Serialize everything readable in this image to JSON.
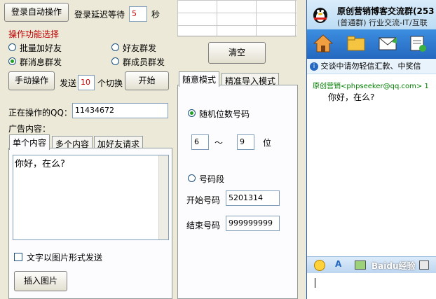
{
  "left": {
    "login_button": "登录自动操作",
    "delay_label": "登录延迟等待",
    "delay_value": "5",
    "delay_unit": "秒",
    "section_title": "操作功能选择",
    "radios": [
      {
        "label": "批量加好友",
        "checked": false
      },
      {
        "label": "好友群发",
        "checked": false
      },
      {
        "label": "群消息群发",
        "checked": true
      },
      {
        "label": "群成员群发",
        "checked": false
      }
    ],
    "manual_button": "手动操作",
    "send_label": "发送",
    "send_value": "10",
    "switch_label": "个切换",
    "start_button": "开始",
    "current_qq_label": "正在操作的QQ：",
    "current_qq_value": "11434672",
    "ad_label": "广告内容：",
    "tabs": [
      "单个内容",
      "多个内容",
      "加好友请求"
    ],
    "message": "你好，在么?",
    "image_send_label": "文字以图片形式发送",
    "insert_image_button": "插入图片"
  },
  "middle": {
    "clear_button": "清空",
    "tabs": [
      "随意模式",
      "精准导入模式"
    ],
    "random_radio": "随机位数号码",
    "min_digits": "6",
    "tilde": "～",
    "max_digits": "9",
    "digit_unit": "位",
    "range_radio": "号码段",
    "start_label": "开始号码",
    "start_value": "5201314",
    "end_label": "结束号码",
    "end_value": "999999999"
  },
  "qq": {
    "group_title": "原创营销博客交流群(253",
    "group_sub": "(普通群) 行业交流-IT/互联",
    "notice": "交谈中请勿轻信汇款、中奖信",
    "sender": "原创营销<phpseeker@qq.com>  1",
    "message": "你好，在么?",
    "watermark": "Baidu经验"
  },
  "colors": {
    "accent_red": "#c00000",
    "link_green": "#008000",
    "qq_blue": "#2468c0"
  }
}
